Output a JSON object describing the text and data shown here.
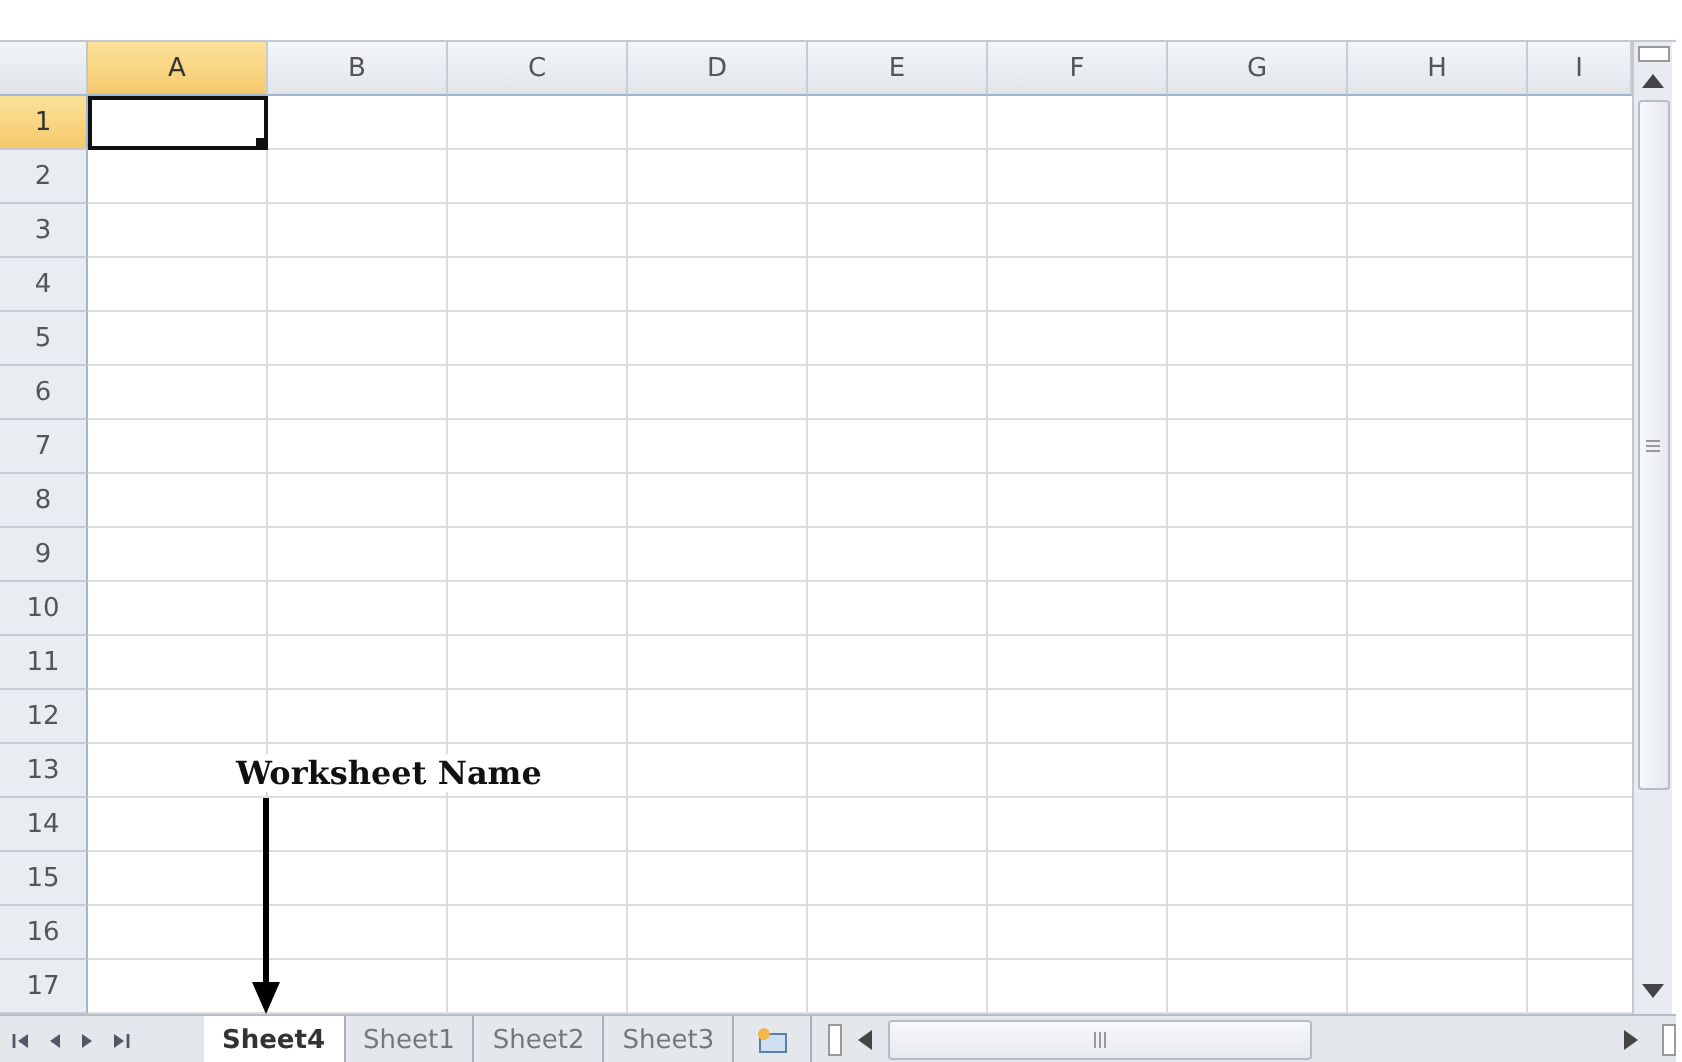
{
  "columns": [
    {
      "label": "A",
      "selected": true
    },
    {
      "label": "B",
      "selected": false
    },
    {
      "label": "C",
      "selected": false
    },
    {
      "label": "D",
      "selected": false
    },
    {
      "label": "E",
      "selected": false
    },
    {
      "label": "F",
      "selected": false
    },
    {
      "label": "G",
      "selected": false
    },
    {
      "label": "H",
      "selected": false
    },
    {
      "label": "I",
      "selected": false
    }
  ],
  "rows": [
    {
      "label": "1",
      "selected": true
    },
    {
      "label": "2",
      "selected": false
    },
    {
      "label": "3",
      "selected": false
    },
    {
      "label": "4",
      "selected": false
    },
    {
      "label": "5",
      "selected": false
    },
    {
      "label": "6",
      "selected": false
    },
    {
      "label": "7",
      "selected": false
    },
    {
      "label": "8",
      "selected": false
    },
    {
      "label": "9",
      "selected": false
    },
    {
      "label": "10",
      "selected": false
    },
    {
      "label": "11",
      "selected": false
    },
    {
      "label": "12",
      "selected": false
    },
    {
      "label": "13",
      "selected": false
    },
    {
      "label": "14",
      "selected": false
    },
    {
      "label": "15",
      "selected": false
    },
    {
      "label": "16",
      "selected": false
    },
    {
      "label": "17",
      "selected": false
    }
  ],
  "sheet_tabs": [
    {
      "label": "Sheet4",
      "selected": true
    },
    {
      "label": "Sheet1",
      "selected": false
    },
    {
      "label": "Sheet2",
      "selected": false
    },
    {
      "label": "Sheet3",
      "selected": false
    }
  ],
  "annotation": {
    "label": "Worksheet Name"
  }
}
